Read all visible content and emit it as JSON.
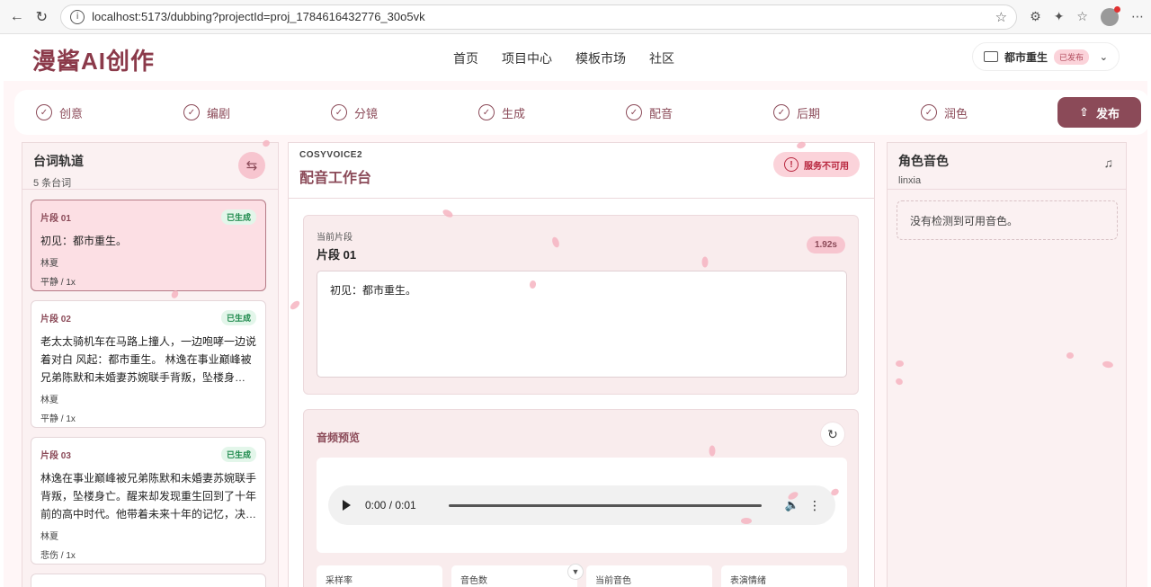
{
  "browser": {
    "url": "localhost:5173/dubbing?projectId=proj_1784616432776_30o5vk"
  },
  "app": {
    "logo": "漫酱AI创作",
    "menu": [
      "首页",
      "项目中心",
      "模板市场",
      "社区"
    ],
    "project": {
      "name": "都市重生",
      "status": "已发布"
    }
  },
  "steps": [
    "创意",
    "编剧",
    "分镜",
    "生成",
    "配音",
    "后期",
    "润色"
  ],
  "publish_label": "发布",
  "left_panel": {
    "title": "台词轨道",
    "subtitle": "5 条台词",
    "items": [
      {
        "segment": "片段 01",
        "status": "已生成",
        "text": "初见：都市重生。",
        "speaker": "林夏",
        "emotion": "平静 / 1x"
      },
      {
        "segment": "片段 02",
        "status": "已生成",
        "text": "老太太骑机车在马路上撞人，一边咆哮一边说着对白 风起：都市重生。 林逸在事业巅峰被兄弟陈默和未婚妻苏婉联手背叛，坠楼身亡。…",
        "speaker": "林夏",
        "emotion": "平静 / 1x"
      },
      {
        "segment": "片段 03",
        "status": "已生成",
        "text": "林逸在事业巅峰被兄弟陈默和未婚妻苏婉联手背叛，坠楼身亡。醒来却发现重生回到了十年前的高中时代。他带着未来十年的记忆，决…",
        "speaker": "林夏",
        "emotion": "悲伤 / 1x"
      }
    ]
  },
  "center": {
    "engine": "COSYVOICE2",
    "title": "配音工作台",
    "service_status": "服务不可用",
    "current_label": "当前片段",
    "current_segment": "片段 01",
    "duration": "1.92s",
    "text": "初见：都市重生。",
    "audio_title": "音频预览",
    "time": "0:00 / 0:01",
    "stats": [
      "采样率",
      "音色数",
      "当前音色",
      "表演情绪"
    ]
  },
  "right_panel": {
    "title": "角色音色",
    "subtitle": "linxia",
    "empty": "没有检测到可用音色。"
  },
  "colors": {
    "brand": "#8b4a58",
    "accent_pink": "#f7c5cf",
    "success": "#1f8a4d",
    "error": "#b8263e"
  }
}
